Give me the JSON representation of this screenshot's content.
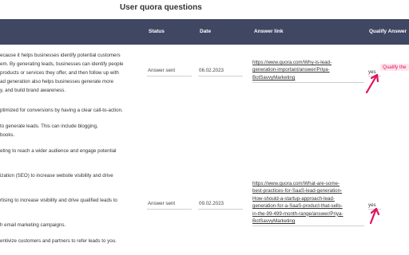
{
  "page": {
    "title": "User quora questions"
  },
  "columns": {
    "status": "Status",
    "date": "Date",
    "answer_link": "Answer link",
    "qualify": "Qualify Answer"
  },
  "row1_text": [
    "ecause it helps businesses identify potential customers",
    "em. By generating leads, businesses can identify people",
    "products or services they offer, and then follow up with",
    "ad generation also helps businesses generate more",
    "y, and build brand awareness."
  ],
  "middle_text": [
    "ptimized for conversions by having a clear call-to-action.",
    "to generate leads. This can include blogging,",
    "books.",
    "eting to reach a wider audience and engage potential",
    "ization (SEO) to increase website visibility and drive",
    "rtising to increase visibility and drive qualified leads to",
    "h email marketing campaigns.",
    "entivize customers and partners to refer leads to you."
  ],
  "rows": [
    {
      "status": "Answer sent",
      "date": "06.02.2023",
      "link_lines": [
        "https://www.quora.com/Why-is-lead-",
        "generation-important/answer/Priya-",
        "BotSavvyMarketing"
      ],
      "qualify": "yes"
    },
    {
      "status": "Answer sent",
      "date": "09.02.2023",
      "link_lines": [
        "https://www.quora.com/What-are-some-",
        "best-practices-for-SaaS-lead-generation-",
        "How-should-a-startup-approach-lead-",
        "generation-for-a-SaaS-product-that-sells-",
        "in-the-99-499-month-range/answer/Priya-",
        "BotSavvyMarketing"
      ],
      "qualify": "yes"
    }
  ],
  "qualify_tag": "Qualify the",
  "colors": {
    "header": "#3f4762",
    "accent": "#e0115f",
    "tag_bg": "#ffe6ec"
  },
  "icons": {
    "arrow": "pink-arrow-icon"
  }
}
